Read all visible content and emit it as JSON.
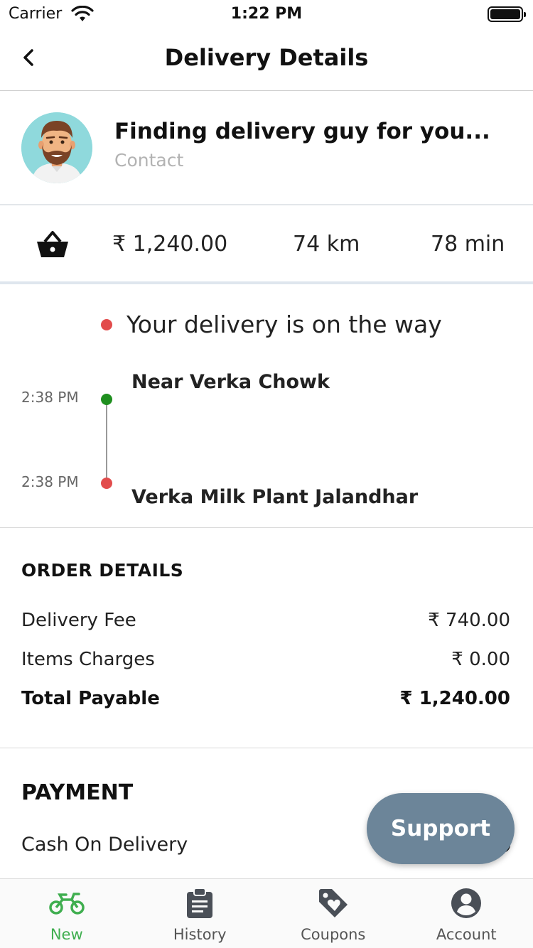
{
  "status_bar": {
    "carrier": "Carrier",
    "time": "1:22 PM"
  },
  "header": {
    "title": "Delivery Details",
    "back_icon": "chevron-left-icon"
  },
  "driver": {
    "name": "Finding delivery guy for you...",
    "contact_label": "Contact"
  },
  "summary": {
    "price": "₹ 1,240.00",
    "distance": "74 km",
    "duration": "78 min",
    "icon": "basket-icon"
  },
  "tracking": {
    "status": "Your delivery is on the way",
    "pickup": {
      "time": "2:38 PM",
      "place": "Near Verka Chowk"
    },
    "dropoff": {
      "time": "2:38 PM",
      "place": "Verka Milk Plant Jalandhar"
    }
  },
  "order_details": {
    "title": "ORDER DETAILS",
    "rows": [
      {
        "label": "Delivery Fee",
        "value": "₹ 740.00"
      },
      {
        "label": "Items Charges",
        "value": "₹ 0.00"
      },
      {
        "label": "Total Payable",
        "value": "₹ 1,240.00"
      }
    ]
  },
  "payment": {
    "title": "PAYMENT",
    "method": "Cash On Delivery"
  },
  "support": {
    "label": "Support"
  },
  "tabs": [
    {
      "label": "New",
      "icon": "motorbike-icon",
      "active": true
    },
    {
      "label": "History",
      "icon": "clipboard-icon",
      "active": false
    },
    {
      "label": "Coupons",
      "icon": "tag-heart-icon",
      "active": false
    },
    {
      "label": "Account",
      "icon": "user-circle-icon",
      "active": false
    }
  ],
  "colors": {
    "accent_green": "#3fae4f",
    "status_red": "#e24c4c",
    "pickup_green": "#1f8f1f",
    "support_button": "#6c8599"
  }
}
